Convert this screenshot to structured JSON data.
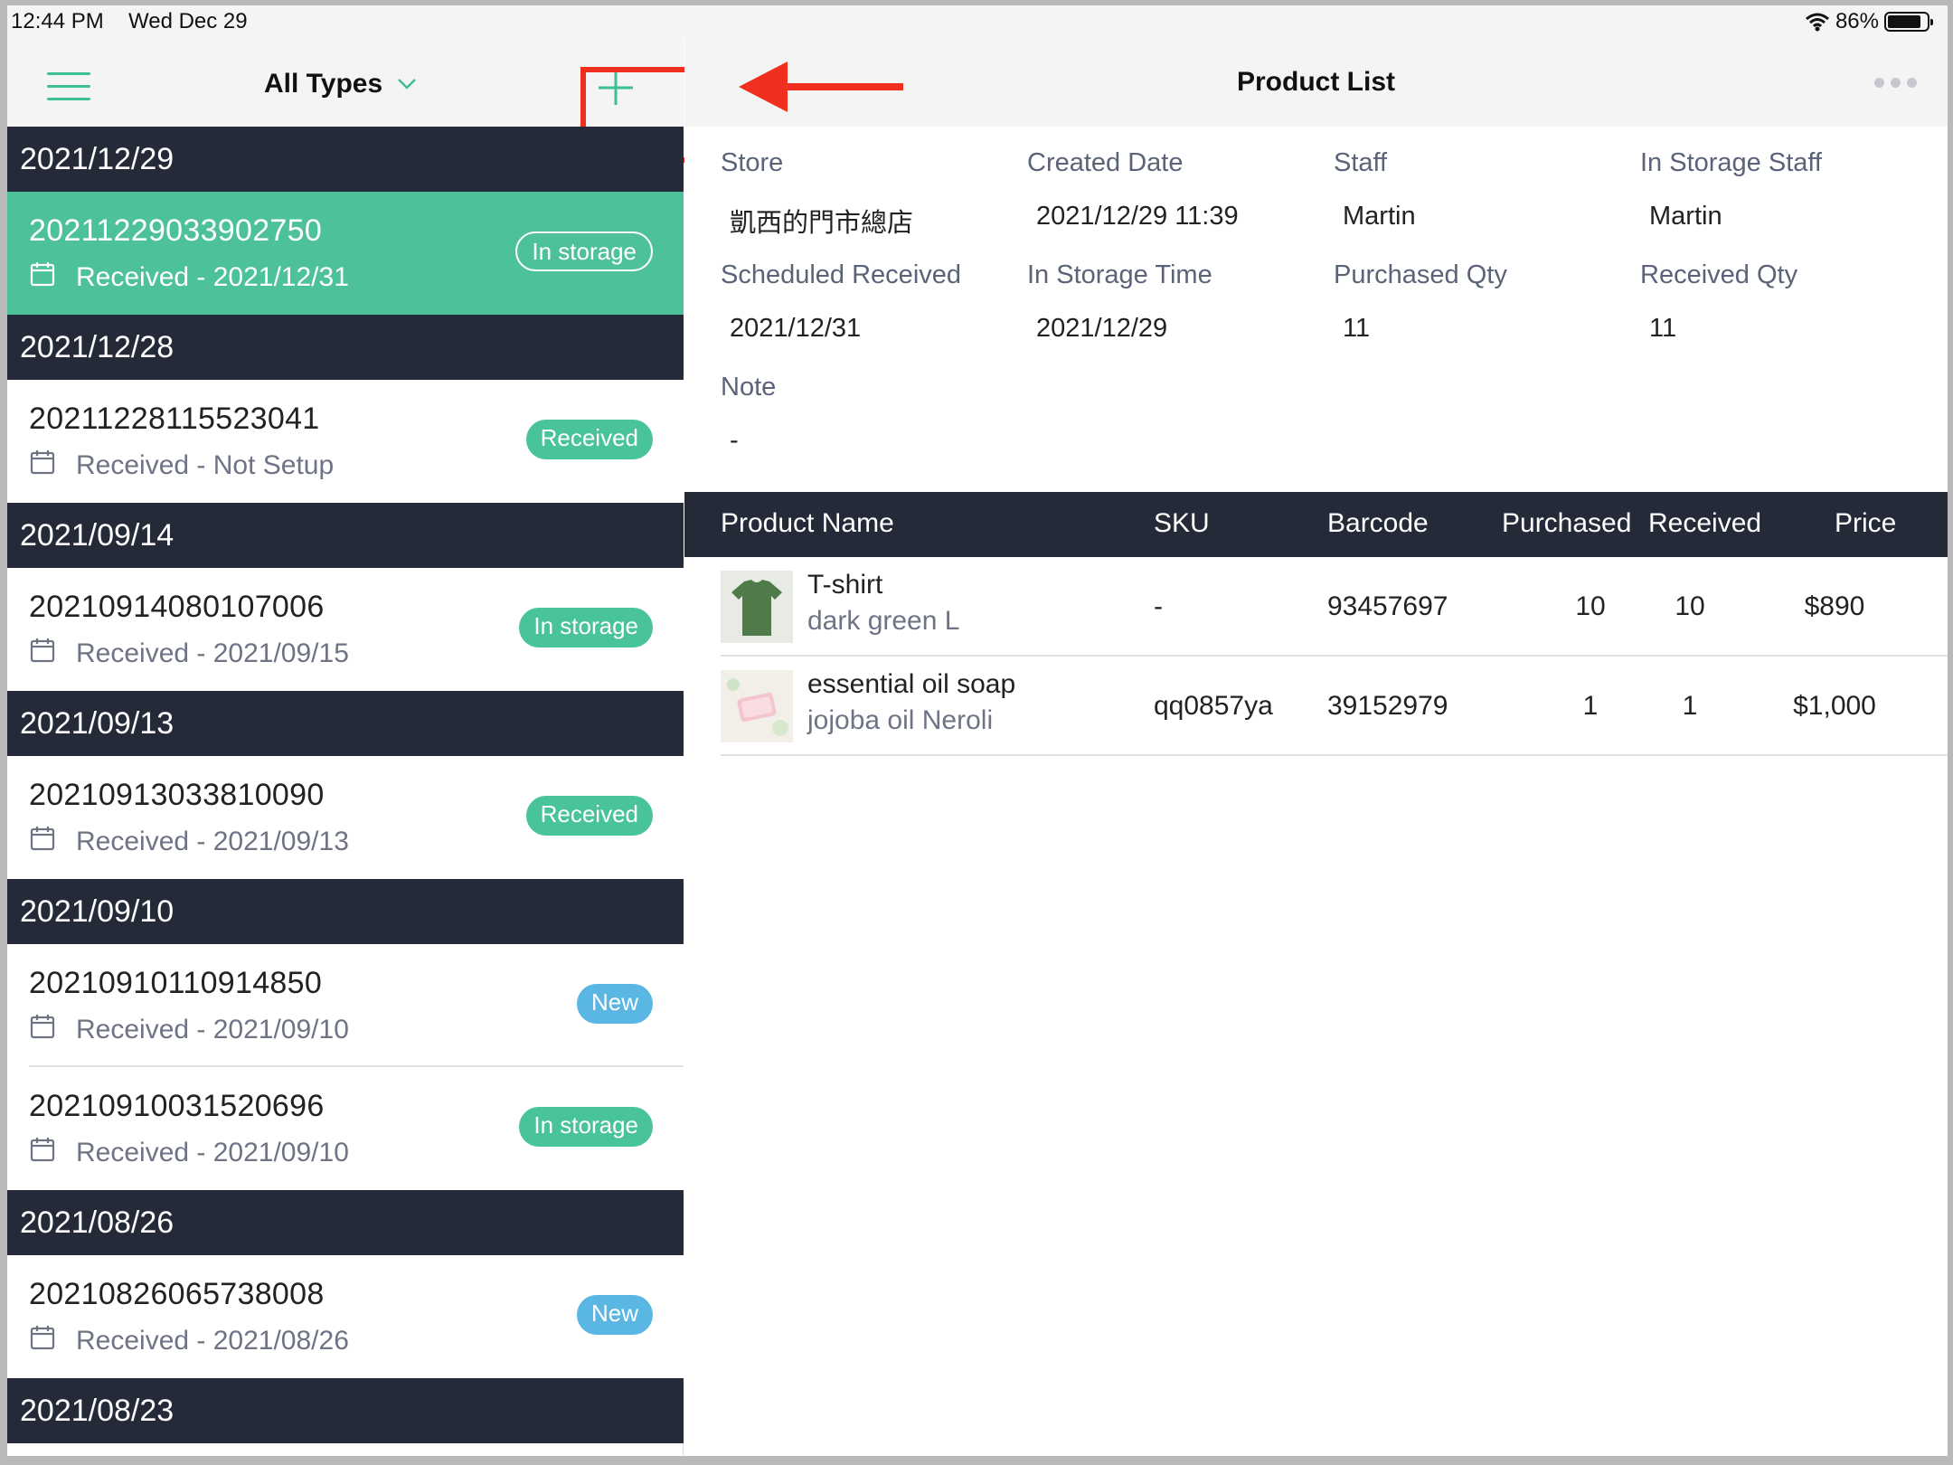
{
  "status_bar": {
    "time": "12:44 PM",
    "date": "Wed Dec 29",
    "battery": "86%"
  },
  "left_header": {
    "filter_label": "All Types"
  },
  "groups": [
    {
      "date": "2021/12/29",
      "entries": [
        {
          "number": "20211229033902750",
          "received": "Received - 2021/12/31",
          "status": "In storage",
          "status_type": "storage",
          "active": true
        }
      ]
    },
    {
      "date": "2021/12/28",
      "entries": [
        {
          "number": "20211228115523041",
          "received": "Received - Not Setup",
          "status": "Received",
          "status_type": "received"
        }
      ]
    },
    {
      "date": "2021/09/14",
      "entries": [
        {
          "number": "20210914080107006",
          "received": "Received - 2021/09/15",
          "status": "In storage",
          "status_type": "storage"
        }
      ]
    },
    {
      "date": "2021/09/13",
      "entries": [
        {
          "number": "20210913033810090",
          "received": "Received - 2021/09/13",
          "status": "Received",
          "status_type": "received"
        }
      ]
    },
    {
      "date": "2021/09/10",
      "entries": [
        {
          "number": "20210910110914850",
          "received": "Received - 2021/09/10",
          "status": "New",
          "status_type": "new"
        },
        {
          "number": "20210910031520696",
          "received": "Received - 2021/09/10",
          "status": "In storage",
          "status_type": "storage"
        }
      ]
    },
    {
      "date": "2021/08/26",
      "entries": [
        {
          "number": "20210826065738008",
          "received": "Received - 2021/08/26",
          "status": "New",
          "status_type": "new"
        }
      ]
    },
    {
      "date": "2021/08/23",
      "entries": []
    }
  ],
  "right_header": {
    "title": "Product List"
  },
  "details": {
    "store_label": "Store",
    "store": "凱西的門市總店",
    "created_label": "Created Date",
    "created": "2021/12/29 11:39",
    "staff_label": "Staff",
    "staff": "Martin",
    "storage_staff_label": "In Storage Staff",
    "storage_staff": "Martin",
    "scheduled_label": "Scheduled Received",
    "scheduled": "2021/12/31",
    "storage_time_label": "In Storage Time",
    "storage_time": "2021/12/29",
    "purchased_qty_label": "Purchased Qty",
    "purchased_qty": "11",
    "received_qty_label": "Received Qty",
    "received_qty": "11",
    "note_label": "Note",
    "note": "-"
  },
  "table": {
    "headers": {
      "name": "Product Name",
      "sku": "SKU",
      "barcode": "Barcode",
      "purchased": "Purchased",
      "received": "Received",
      "price": "Price"
    },
    "rows": [
      {
        "name": "T-shirt",
        "variant": "dark green L",
        "sku": "-",
        "barcode": "93457697",
        "purchased": "10",
        "received": "10",
        "price": "$890",
        "thumb": "shirt"
      },
      {
        "name": "essential oil soap",
        "variant": "jojoba oil Neroli",
        "sku": "qq0857ya",
        "barcode": "39152979",
        "purchased": "1",
        "received": "1",
        "price": "$1,000",
        "thumb": "soap"
      }
    ]
  },
  "colors": {
    "accent": "#4dc29a",
    "dark_header": "#252a38",
    "new_badge": "#5ab6e2",
    "highlight": "#f0301f"
  }
}
